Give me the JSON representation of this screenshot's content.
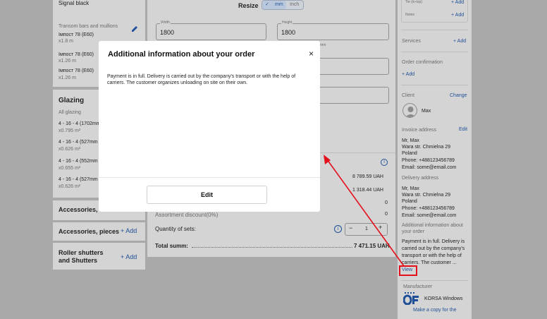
{
  "left": {
    "signal": "Signal black",
    "transom_title": "Transom bars and mullions",
    "imposts": [
      {
        "name": "Імпост 78 (E60)",
        "qty": "x1.8 m"
      },
      {
        "name": "Імпост 78 (E60)",
        "qty": "x1.26 m"
      },
      {
        "name": "Імпост 78 (E60)",
        "qty": "x1.26 m"
      }
    ],
    "glazing_title": "Glazing",
    "all_glazing": "All glazing",
    "glazing_items": [
      {
        "name": "4 - 16 - 4 (1702mm",
        "qty": "x0.795 m²"
      },
      {
        "name": "4 - 16 - 4 (527mm",
        "qty": "x0.626 m²"
      },
      {
        "name": "4 - 16 - 4 (552mm",
        "qty": "x0.655 m²"
      },
      {
        "name": "4 - 16 - 4 (527mm",
        "qty": "x0.626 m²"
      }
    ],
    "accessories_s": "Accessories, s",
    "accessories_pieces": "Accessories, pieces",
    "roller_shutters": "Roller shutters and Shutters",
    "add_label": "+ Add"
  },
  "center": {
    "resize_label": "Resize",
    "mm_label": "mm",
    "inch_label": "Inch",
    "width_label": "Width",
    "width_value": "1800",
    "height_label": "Height",
    "height_value": "1800",
    "mm_suffix": "mm",
    "price1": "8 789.59 UAH",
    "price2": "1 318.44 UAH",
    "zero1": "0",
    "zero2": "0",
    "assortment_discount": "Assortment discount(0%)",
    "quantity_label": "Quantity of sets:",
    "quantity_value": "1",
    "total_label": "Total summ:",
    "total_value": "7 471.15 UAH"
  },
  "right": {
    "tie_in_top": "Tie (in-top)",
    "notes": "Notes",
    "add": "+ Add",
    "services": "Services",
    "order_confirmation": "Order confirmation",
    "client_label": "Client",
    "change": "Change",
    "client_name": "Max",
    "invoice_address": "Invoice address",
    "edit": "Edit",
    "invoice_lines": [
      "Mr, Max",
      "Wara str. Chmielna 29",
      "Poland",
      "Phone: +488123456789",
      "Email: some@email.com"
    ],
    "delivery_address": "Delivery address",
    "delivery_lines": [
      "Mr, Max",
      "Wara str. Chmielna 29",
      "Poland",
      "Phone: +488123456789",
      "Email: some@email.com"
    ],
    "additional_info_label": "Additional information about your order",
    "additional_info_preview": "Payment is in full. Delivery is carried out by the company's transport or with the help of carriers. The customer ...",
    "view": "View",
    "manufacturer_label": "Manufacturer",
    "manufacturer_name": "KORSA Windows",
    "make_copy": "Make a copy for the"
  },
  "modal": {
    "title": "Additional information about your order",
    "close": "×",
    "body": "Payment is in full. Delivery is carried out by the company's transport or with the help of carriers. The customer organizes unloading on site on their own.",
    "edit_button": "Edit"
  },
  "colors": {
    "accent": "#1f4f97",
    "highlight": "#e3101c",
    "overlay": "#a9a9a9"
  }
}
